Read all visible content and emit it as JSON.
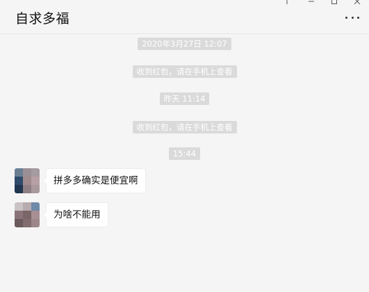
{
  "window": {
    "title": "自求多福",
    "controls": [
      "pin-icon",
      "minimize-icon",
      "maximize-icon",
      "close-icon"
    ],
    "more_icon": "more-icon"
  },
  "messages": {
    "stamp_1": "2020年3月27日 12:07",
    "system_1": "收到红包，请在手机上查看",
    "stamp_2": "昨天 11:14",
    "system_2": "收到红包，请在手机上查看",
    "stamp_3": "15:44",
    "chat": [
      {
        "text": "拼多多确实是便宜啊"
      },
      {
        "text": "为啥不能用"
      }
    ]
  },
  "colors": {
    "background": "#f5f5f5",
    "stamp_bg": "#dadada",
    "bubble_bg": "#ffffff"
  }
}
